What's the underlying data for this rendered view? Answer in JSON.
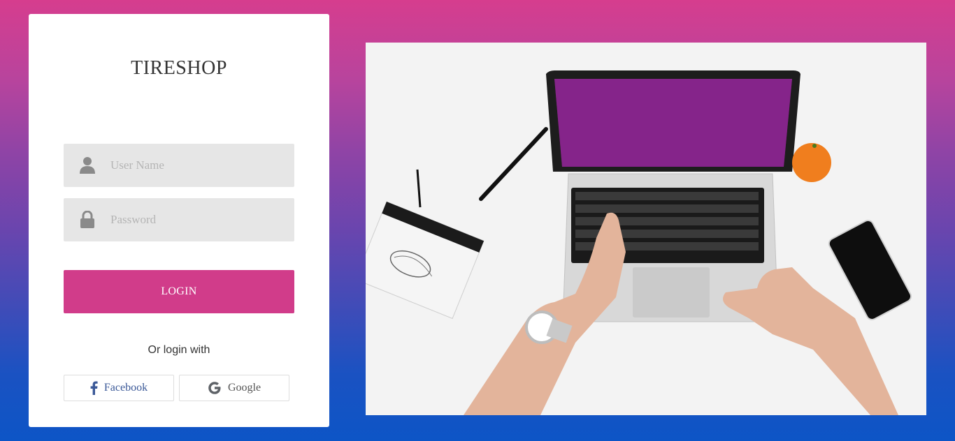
{
  "brand": {
    "title": "TIRESHOP"
  },
  "form": {
    "username_placeholder": "User Name",
    "password_placeholder": "Password",
    "login_label": "LOGIN"
  },
  "social": {
    "or_text": "Or login with",
    "facebook_label": "Facebook",
    "google_label": "Google"
  },
  "colors": {
    "accent": "#d13c8a",
    "facebook": "#3b5998",
    "background_top": "#d63d8e",
    "background_bottom": "#0d55c6"
  },
  "icons": {
    "username": "user-icon",
    "password": "lock-icon",
    "facebook": "facebook-icon",
    "google": "google-icon"
  }
}
